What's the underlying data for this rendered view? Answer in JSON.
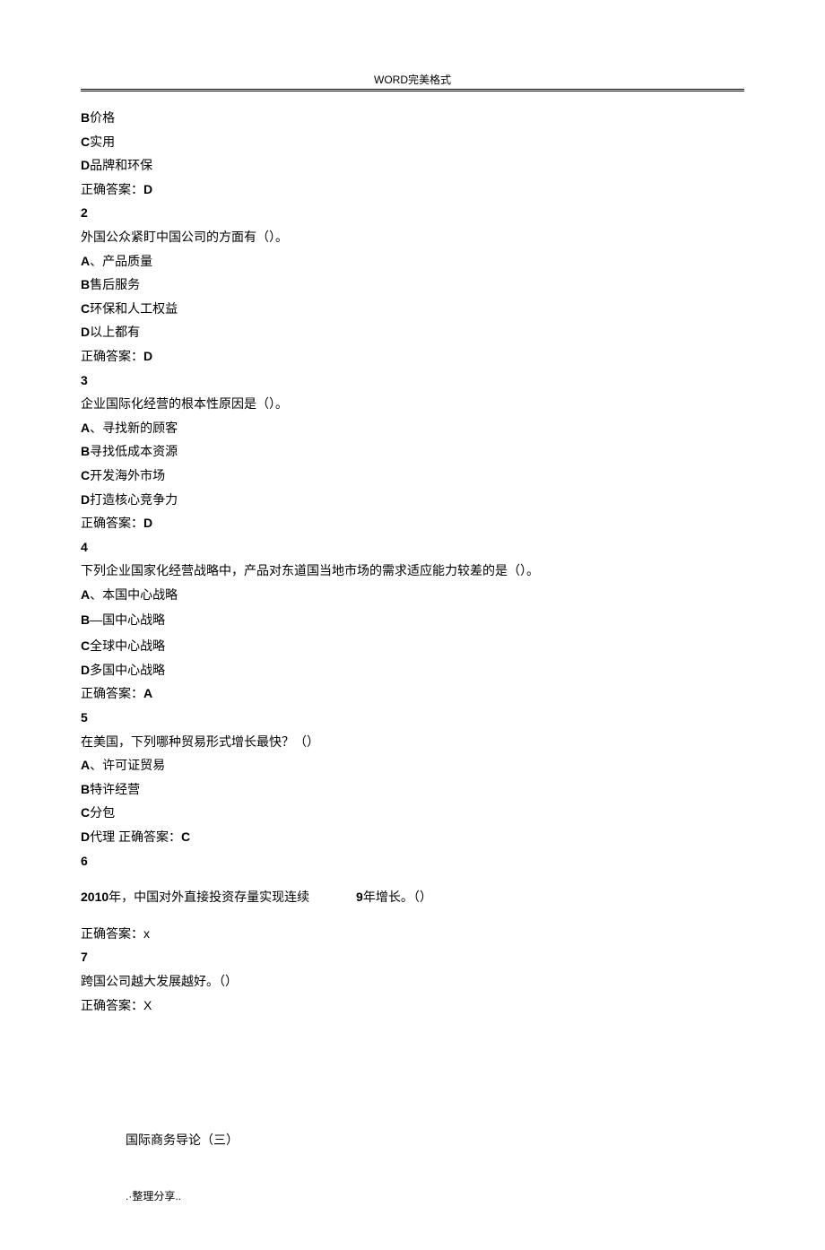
{
  "header": "WORD完美格式",
  "q1": {
    "optB": "B价格",
    "optC": "C实用",
    "optD": "D品牌和环保",
    "answerLabel": "正确答案：",
    "answer": "D"
  },
  "q2": {
    "num": "2",
    "stem": "外国公众紧盯中国公司的方面有（）。",
    "optA": "A、产品质量",
    "optB": "B售后服务",
    "optC": "C环保和人工权益",
    "optD": "D以上都有",
    "answerLabel": "正确答案：",
    "answer": "D"
  },
  "q3": {
    "num": "3",
    "stem": "企业国际化经营的根本性原因是（）。",
    "optA": "A、寻找新的顾客",
    "optB": "B寻找低成本资源",
    "optC": "C开发海外市场",
    "optD": "D打造核心竞争力",
    "answerLabel": "正确答案：",
    "answer": "D"
  },
  "q4": {
    "num": "4",
    "stem": "下列企业国家化经营战略中，产品对东道国当地市场的需求适应能力较差的是（）。",
    "optA": "A、本国中心战略",
    "optB": "B—国中心战略",
    "optC": "C全球中心战略",
    "optD": "D多国中心战略",
    "answerLabel": "正确答案：",
    "answer": "A"
  },
  "q5": {
    "num": "5",
    "stem": "在美国，下列哪种贸易形式增长最快？（）",
    "optA": "A、许可证贸易",
    "optB": "B特许经营",
    "optC": "C分包",
    "optD_prefix": "D代理 正确答案：",
    "optD_answer": "C"
  },
  "q6": {
    "num": "6",
    "stem_part1": "2010",
    "stem_part2": "年，中国对外直接投资存量实现连续",
    "stem_part3": "9",
    "stem_part4": "年增长。（）",
    "answerLabel": "正确答案：x"
  },
  "q7": {
    "num": "7",
    "stem": "跨国公司越大发展越好。（）",
    "answerLabel": "正确答案：X"
  },
  "section_title": "国际商务导论（三）",
  "footer": ".·整理分享.."
}
